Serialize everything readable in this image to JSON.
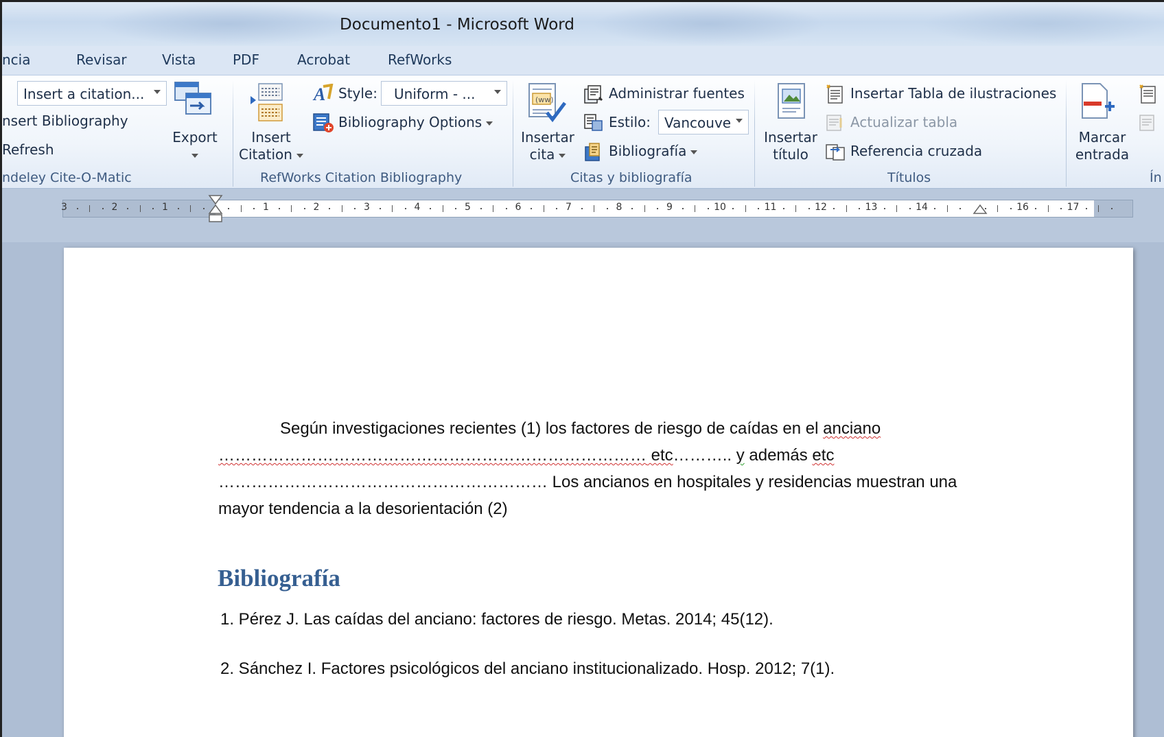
{
  "window": {
    "title": "Documento1  -  Microsoft Word"
  },
  "tabs": [
    "ncia",
    "Revisar",
    "Vista",
    "PDF",
    "Acrobat",
    "RefWorks"
  ],
  "ribbon": {
    "mendeley": {
      "citation_box": "Insert a citation...",
      "insert_bibliography": "nsert Bibliography",
      "refresh": "Refresh",
      "export": "Export",
      "group_label": "ndeley Cite-O-Matic"
    },
    "refworks": {
      "insert_citation": [
        "Insert",
        "Citation"
      ],
      "style_label": "Style:",
      "style_value": "Uniform - ...",
      "bibliography_options": "Bibliography Options",
      "group_label": "RefWorks Citation  Bibliography"
    },
    "citas": {
      "insertar_cita": [
        "Insertar",
        "cita"
      ],
      "administrar_fuentes": "Administrar fuentes",
      "estilo_label": "Estilo:",
      "estilo_value": "Vancouve",
      "bibliografia": "Bibliografía",
      "group_label": "Citas y bibliografía"
    },
    "titulos": {
      "insertar_titulo": [
        "Insertar",
        "título"
      ],
      "insertar_tabla": "Insertar Tabla de ilustraciones",
      "actualizar_tabla": "Actualizar tabla",
      "referencia_cruzada": "Referencia cruzada",
      "group_label": "Títulos"
    },
    "indice": {
      "marcar_entrada": [
        "Marcar",
        "entrada"
      ],
      "group_label": "Ín"
    }
  },
  "ruler": {
    "left_labels": [
      "3",
      "2",
      "1"
    ],
    "right_labels": [
      "1",
      "2",
      "3",
      "4",
      "5",
      "6",
      "7",
      "8",
      "9",
      "10",
      "11",
      "12",
      "13",
      "14",
      "16",
      "17"
    ]
  },
  "document": {
    "para_line1_a": "Según investigaciones recientes (1) los factores de riesgo de caídas en el ",
    "para_line1_b": "anciano",
    "para_line2_a": "……………………………………………………………………",
    "para_line2_b": "  etc",
    "para_line2_c": "……….. ",
    "para_line2_d": "y",
    "para_line2_e": " además ",
    "para_line2_f": "etc",
    "para_line3": "……………………………………………………  Los ancianos en hospitales y residencias muestran una",
    "para_line4": "mayor tendencia a la desorientación (2)",
    "bibliography_heading": "Bibliografía",
    "references": [
      "1. Pérez J. Las caídas del anciano: factores de riesgo. Metas. 2014; 45(12).",
      "2. Sánchez I. Factores psicológicos del anciano institucionalizado. Hosp. 2012; 7(1)."
    ]
  },
  "colors": {
    "heading": "#365f91",
    "ribbon_text": "#1e395b",
    "spell_error": "#d03030"
  }
}
